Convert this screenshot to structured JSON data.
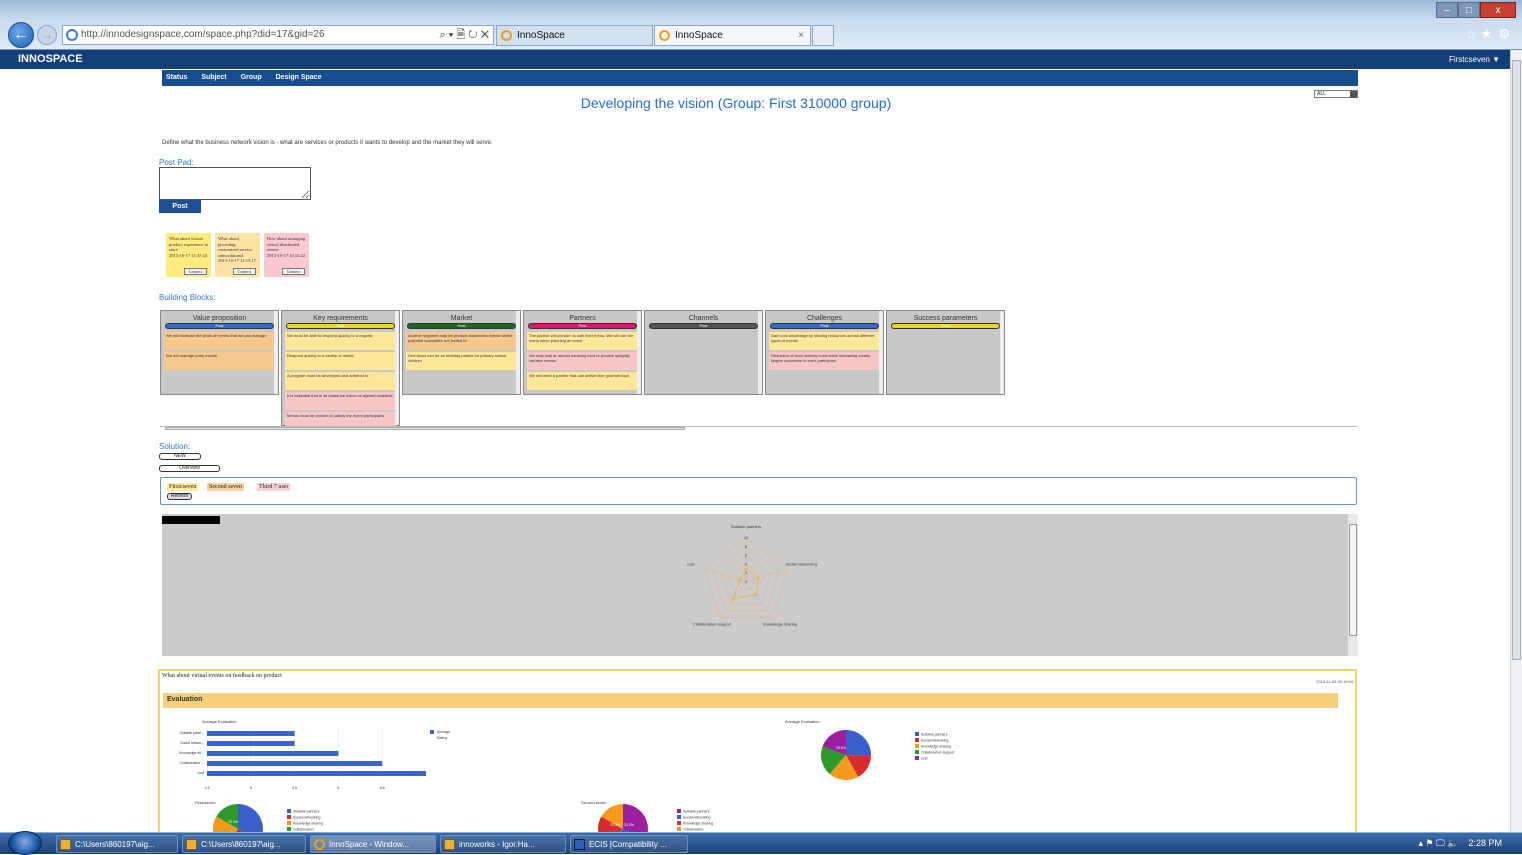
{
  "browser": {
    "url": "http://innodesignspace.com/space.php?did=17&gid=26",
    "addr_tools": "⌕ ▾ 🗎 ↻ ✕",
    "tabs": [
      {
        "label": "InnoSpace"
      },
      {
        "label": "InnoSpace"
      }
    ],
    "tab_close": "×",
    "back": "←",
    "forward": "→",
    "window_controls": {
      "min": "–",
      "max": "□",
      "close": "x"
    },
    "tools": "⌂★⚙"
  },
  "app": {
    "brand": "INNOSPACE",
    "user": "Firstcseven ▼"
  },
  "menu": [
    "Status",
    "Subject",
    "Group",
    "Design Space"
  ],
  "page": {
    "title": "Developing the vision (Group: First 310000 group)",
    "filter": "ALL",
    "description": "Define what the business network vision is - what are services or products it wants to develop and the market they will serve.",
    "postpad_label": "Post Pad:",
    "post_button": "Post"
  },
  "notes": [
    {
      "text": "What about virtual product experience in store",
      "date": "2013-10-17 11:37:44",
      "color": "#ffeb80",
      "button": "Connect"
    },
    {
      "text": "What about providing customized service subscribtional",
      "date": "2013-10-17 11:19:17",
      "color": "#ffe3a6",
      "button": "Connect"
    },
    {
      "text": "How about arranging virtual distributed events",
      "date": "2013-10-17 10:53:22",
      "color": "#f9c9cf",
      "button": "Connect"
    }
  ],
  "building_blocks": {
    "label": "Building Blocks:",
    "blocks": [
      {
        "title": "Value proposition",
        "bar": "#2f6cd8",
        "bar_label": "Post",
        "cards": [
          {
            "text": "We will increase the kinds of events that we can manage",
            "c": "o"
          },
          {
            "text": "We will manage party events",
            "c": "o"
          }
        ]
      },
      {
        "title": "Key requirements",
        "bar": "#e8d629",
        "bar_label": "Post",
        "cards": [
          {
            "text": "We must be able to respond quickly to a request",
            "c": "y"
          },
          {
            "text": "Respond quickly to a variety of needs",
            "c": "y"
          },
          {
            "text": "A program must be developed and adhered to",
            "c": "y"
          },
          {
            "text": "It is essential that in all cases we follow an agreed schedule",
            "c": "p"
          },
          {
            "text": "Menus must be chosen to satisfy the event participants",
            "c": "p"
          }
        ]
      },
      {
        "title": "Market",
        "bar": "#1a6b1a",
        "bar_label": "Post",
        "cards": [
          {
            "text": "Another segment may be product awareness events where potential customers are invited to",
            "c": "o"
          },
          {
            "text": "One focus can be on birthday parties for primary school children",
            "c": "y"
          }
        ]
      },
      {
        "title": "Partners",
        "bar": "#e01570",
        "bar_label": "Post",
        "cards": [
          {
            "text": "The partner will provide us with their menu. We will use the menu when planning an event",
            "c": "y"
          },
          {
            "text": "We may look at around sourcing food to provide sprightly variable menus",
            "c": "p"
          },
          {
            "text": "We will need a partner that can deliver fine gourmet food",
            "c": "y"
          }
        ]
      },
      {
        "title": "Channels",
        "bar": "#555555",
        "bar_label": "Post",
        "cards": []
      },
      {
        "title": "Challenges",
        "bar": "#2f6cd8",
        "bar_label": "Post",
        "cards": [
          {
            "text": "Gain cost advantage by sharing resources across different types of events",
            "c": "y"
          },
          {
            "text": "Reduction of food delivery costs while increasing variety. Maybe customise to each participant",
            "c": "p"
          }
        ]
      },
      {
        "title": "Success parameters",
        "bar": "#e8d629",
        "bar_label": "Post",
        "cards": []
      }
    ]
  },
  "solution": {
    "label": "Solution:",
    "new_button": "NEW",
    "overview_button": "Overview",
    "filters": [
      {
        "label": "Firstcseven",
        "color": "#ffe9a0"
      },
      {
        "label": "Second seven",
        "color": "#f7d2a6"
      },
      {
        "label": "Third 7 user",
        "color": "#f9d3d3"
      }
    ],
    "refresh": "Refresh"
  },
  "radar": {
    "axes": [
      "Suitable partners",
      "Social networking",
      "Knowledge sharing",
      "Collaboration support",
      "cost"
    ],
    "ticks": [
      "10",
      "8",
      "6",
      "4",
      "2",
      "0"
    ],
    "max": 10,
    "values": [
      3,
      3,
      3.5,
      5,
      1.5
    ]
  },
  "entry": {
    "title": "What about virtual events on feedback on product",
    "date": "2013-11-05 09:19:54",
    "evaluation": "Evaluation"
  },
  "chart_data": [
    {
      "type": "bar",
      "title": "Average Evaluation",
      "orientation": "horizontal",
      "categories": [
        "Suitable partn...",
        "Social networ...",
        "Knowledge sh...",
        "Collaboration ...",
        "cost"
      ],
      "series": [
        {
          "name": "Average Rating",
          "values": [
            5.5,
            5.5,
            6,
            6.5,
            7
          ]
        }
      ],
      "xlim": [
        4.5,
        7
      ],
      "ticks": [
        "4.5",
        "5",
        "5.5",
        "6",
        "6.5"
      ],
      "legend": "top-right",
      "color": "#3a66c8"
    },
    {
      "type": "pie",
      "title": "Average Evaluation",
      "labels": [
        "Suitable partners",
        "Social networking",
        "Knowledge sharing",
        "Collaboration support",
        "cost"
      ],
      "values": [
        25.8,
        16.1,
        19.4,
        19.4,
        19.3
      ],
      "colors": [
        "#3b5fc8",
        "#d62c2c",
        "#f59a1c",
        "#2b9a2b",
        "#9b1fa0"
      ],
      "data_label": "25.8%"
    },
    {
      "type": "pie",
      "title": "Firstcseven",
      "labels": [
        "Suitable partners",
        "Social networking",
        "Knowledge sharing",
        "Collaboration"
      ],
      "values": [
        33.3,
        25,
        25,
        16.7
      ],
      "colors": [
        "#3b5fc8",
        "#d62c2c",
        "#f59a1c",
        "#2b9a2b",
        "#9b1fa0"
      ],
      "data_label": "33.3%"
    },
    {
      "type": "pie",
      "title": "Second seven",
      "labels": [
        "Suitable partners",
        "Social networking",
        "Knowledge sharing",
        "Collaboration"
      ],
      "values": [
        33.3,
        33.3,
        16.7,
        16.7
      ],
      "colors": [
        "#9b1fa0",
        "#3b5fc8",
        "#d62c2c",
        "#f59a1c",
        "#2b9a2b"
      ],
      "data_labels": [
        "33.3%",
        "33.3%"
      ]
    }
  ],
  "taskbar": {
    "items": [
      {
        "label": "C:\\Users\\860197\\aig...",
        "icon": "folder",
        "active": false
      },
      {
        "label": "C:\\Users\\860197\\aig...",
        "icon": "folder",
        "active": false
      },
      {
        "label": "InnoSpace - Window...",
        "icon": "ie",
        "active": true
      },
      {
        "label": "innoworks - Igor.Ha...",
        "icon": "folder",
        "active": false
      },
      {
        "label": "ECIS [Compatibility ...",
        "icon": "word",
        "active": false
      }
    ],
    "clock": "2:28 PM",
    "tray": "▴  ⚑  🖵  🔈"
  }
}
